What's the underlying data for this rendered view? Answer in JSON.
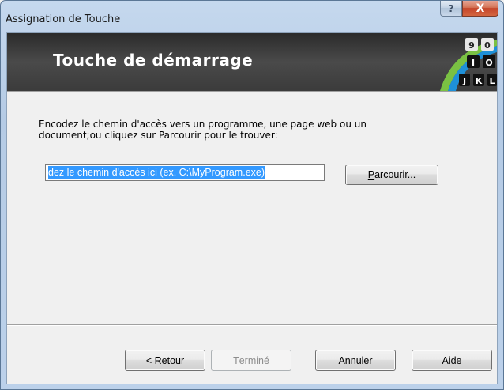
{
  "window": {
    "title": "Assignation de Touche",
    "help_glyph": "?",
    "close_glyph": "X"
  },
  "header": {
    "title": "Touche de démarrage",
    "art_keys": [
      "9",
      "0",
      "I",
      "O",
      "J",
      "K",
      "L"
    ]
  },
  "main": {
    "instructions_line1": "Encodez le chemin d'accès vers un programme, une page web ou un",
    "instructions_line2": "document;ou cliquez sur Parcourir pour le trouver:",
    "path_value": "dez le chemin d'accès ici (ex. C:\\MyProgram.exe)",
    "browse_label_accel": "P",
    "browse_label_rest": "arcourir..."
  },
  "footer": {
    "back_prefix": "< ",
    "back_accel": "R",
    "back_rest": "etour",
    "finish_accel": "T",
    "finish_rest": "erminé",
    "cancel_label": "Annuler",
    "help_label": "Aide"
  },
  "colors": {
    "selection": "#3399ff",
    "header_bg": "#3b3b3b",
    "accent_green": "#7ac143",
    "accent_blue": "#1e90d8"
  }
}
